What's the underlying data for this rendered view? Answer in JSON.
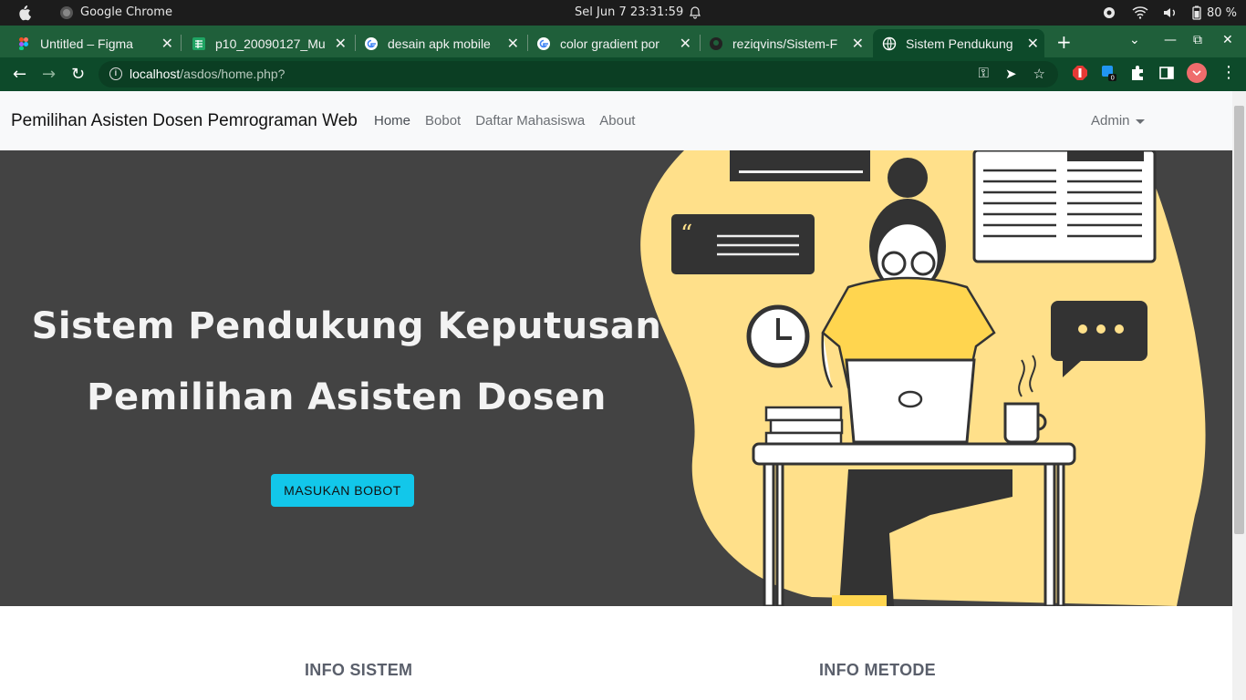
{
  "os": {
    "app_name": "Google Chrome",
    "datetime": "Sel Jun 7  23:31:59",
    "battery": "80 %"
  },
  "tabs": [
    {
      "title": "Untitled – Figma",
      "favicon": "figma-icon",
      "color": "#f24e1e"
    },
    {
      "title": "p10_20090127_Mu",
      "favicon": "sheets-icon",
      "color": "#1fa463"
    },
    {
      "title": "desain apk mobile",
      "favicon": "google-icon",
      "color": "#ffffff"
    },
    {
      "title": "color gradient por",
      "favicon": "google-icon",
      "color": "#ffffff"
    },
    {
      "title": "reziqvins/Sistem-F",
      "favicon": "github-icon",
      "color": "#222222"
    },
    {
      "title": "Sistem Pendukung",
      "favicon": "globe-icon",
      "color": "#ffffff"
    }
  ],
  "address": {
    "host": "localhost",
    "path": "/asdos/home.php?"
  },
  "navbar": {
    "brand": "Pemilihan Asisten Dosen Pemrograman Web",
    "links": [
      "Home",
      "Bobot",
      "Daftar Mahasiswa",
      "About"
    ],
    "user": "Admin"
  },
  "hero": {
    "title_line1": "Sistem Pendukung Keputusan",
    "title_line2": "Pemilihan Asisten Dosen",
    "cta": "MASUKAN BOBOT",
    "bg_color": "#434343",
    "accent": "#ffe08a"
  },
  "sections": {
    "info_sistem": "INFO SISTEM",
    "info_metode": "INFO METODE"
  }
}
